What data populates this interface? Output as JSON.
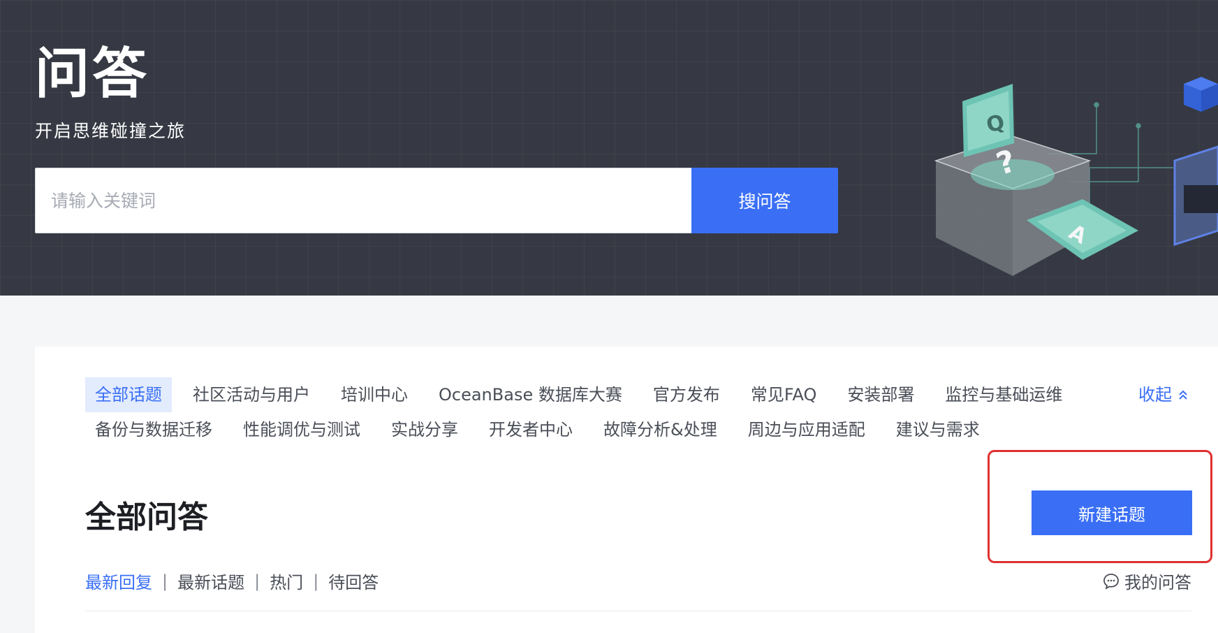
{
  "hero": {
    "title": "问答",
    "subtitle": "开启思维碰撞之旅",
    "search": {
      "placeholder": "请输入关键词",
      "value": "",
      "button_label": "搜问答"
    },
    "illustration_letters": [
      "Q",
      "?",
      "A"
    ]
  },
  "topics": {
    "row1": [
      "全部话题",
      "社区活动与用户",
      "培训中心",
      "OceanBase 数据库大赛",
      "官方发布",
      "常见FAQ",
      "安装部署",
      "监控与基础运维"
    ],
    "row2": [
      "备份与数据迁移",
      "性能调优与测试",
      "实战分享",
      "开发者中心",
      "故障分析&处理",
      "周边与应用适配",
      "建议与需求"
    ],
    "active": "全部话题",
    "collapse_label": "收起"
  },
  "section": {
    "title": "全部问答",
    "new_topic_label": "新建话题",
    "sort_tabs": [
      "最新回复",
      "最新话题",
      "热门",
      "待回答"
    ],
    "active_sort": "最新回复",
    "my_questions_label": "我的问答"
  },
  "colors": {
    "hero_bg": "#363943",
    "accent": "#3a6ff5",
    "active_tag_bg": "#e3ecfd",
    "highlight_border": "#e03030"
  }
}
